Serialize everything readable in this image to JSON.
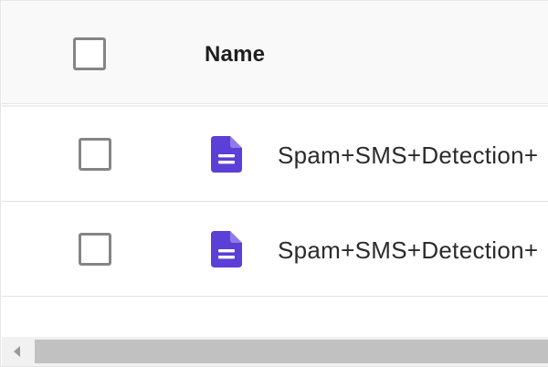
{
  "table": {
    "header": {
      "name_label": "Name"
    },
    "rows": [
      {
        "file_name": "Spam+SMS+Detection+",
        "icon": "document-icon",
        "checked": false
      },
      {
        "file_name": "Spam+SMS+Detection+",
        "icon": "document-icon",
        "checked": false
      }
    ]
  },
  "colors": {
    "file_icon": "#5b3fd6",
    "checkbox_border": "#858585",
    "header_bg": "#f9f9fa",
    "scroll_thumb": "#c1c1c1",
    "scroll_track": "#f1f1f1"
  }
}
